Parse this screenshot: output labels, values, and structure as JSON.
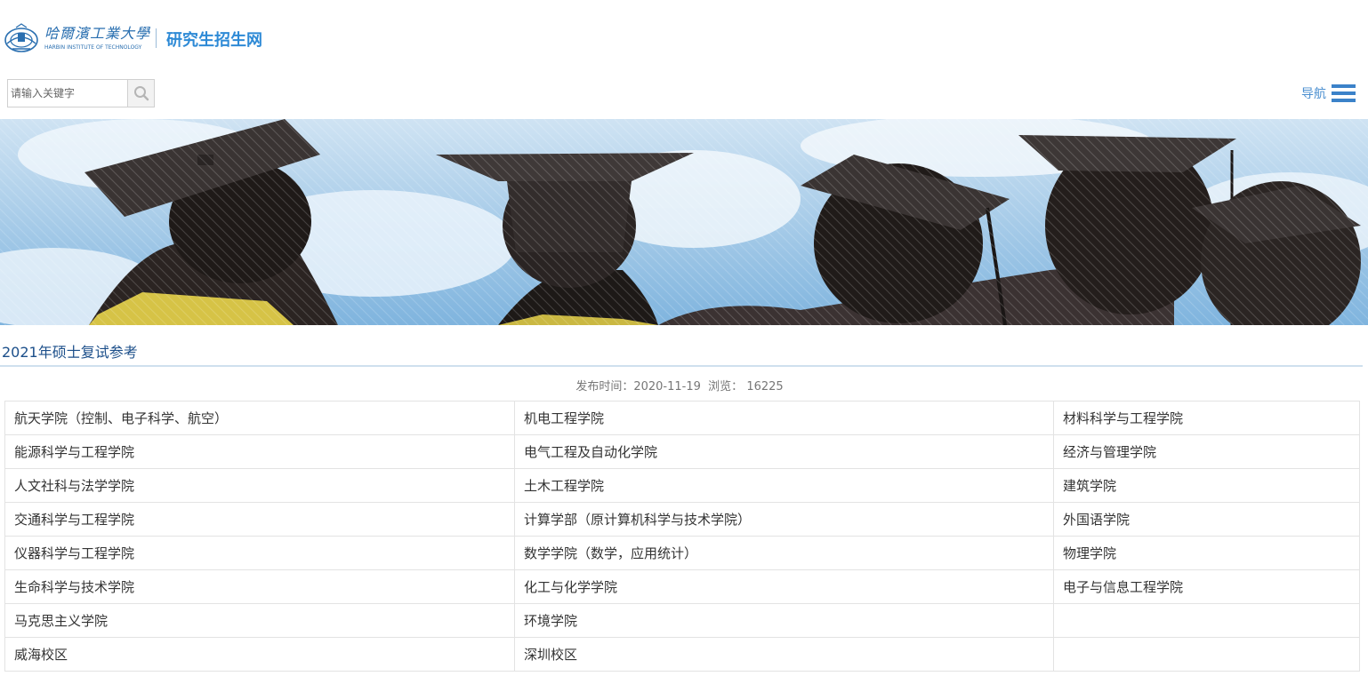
{
  "header": {
    "logo_cn": "哈爾濱工業大學",
    "logo_en": "HARBIN INSTITUTE OF TECHNOLOGY",
    "site_title": "研究生招生网"
  },
  "search": {
    "placeholder": "请输入关键字",
    "icon": "search-icon"
  },
  "nav": {
    "label": "导航",
    "icon": "hamburger-icon"
  },
  "article": {
    "title": "2021年硕士复试参考",
    "publish_label": "发布时间：",
    "publish_date": "2020-11-19",
    "views_label": "浏览：",
    "views": "16225"
  },
  "colleges": [
    [
      "航天学院（控制、电子科学、航空）",
      "机电工程学院",
      "材料科学与工程学院"
    ],
    [
      "能源科学与工程学院",
      "电气工程及自动化学院",
      "经济与管理学院"
    ],
    [
      "人文社科与法学学院",
      "土木工程学院",
      "建筑学院"
    ],
    [
      "交通科学与工程学院",
      "计算学部（原计算机科学与技术学院）",
      "外国语学院"
    ],
    [
      "仪器科学与工程学院",
      "数学学院（数学，应用统计）",
      "物理学院"
    ],
    [
      "生命科学与技术学院",
      "化工与化学学院",
      "电子与信息工程学院"
    ],
    [
      "马克思主义学院",
      "环境学院",
      ""
    ],
    [
      "威海校区",
      "深圳校区",
      ""
    ]
  ],
  "colors": {
    "brand_blue": "#2e8ad6",
    "title_blue": "#1c4f8a",
    "nav_blue": "#3b82c9"
  }
}
